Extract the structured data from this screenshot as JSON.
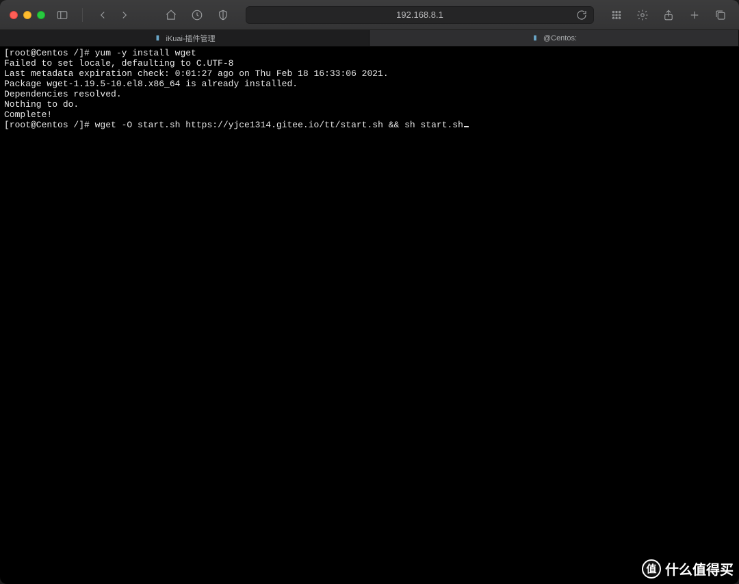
{
  "toolbar": {
    "address": "192.168.8.1"
  },
  "tabs": [
    {
      "label": "iKuai-插件管理",
      "active": false
    },
    {
      "label": "@Centos:",
      "active": true
    }
  ],
  "terminal": {
    "lines": [
      "[root@Centos /]# yum -y install wget",
      "Failed to set locale, defaulting to C.UTF-8",
      "Last metadata expiration check: 0:01:27 ago on Thu Feb 18 16:33:06 2021.",
      "Package wget-1.19.5-10.el8.x86_64 is already installed.",
      "Dependencies resolved.",
      "Nothing to do.",
      "Complete!",
      "[root@Centos /]# wget -O start.sh https://yjce1314.gitee.io/tt/start.sh && sh start.sh"
    ]
  },
  "watermark": {
    "badge": "值",
    "text": "什么值得买"
  }
}
